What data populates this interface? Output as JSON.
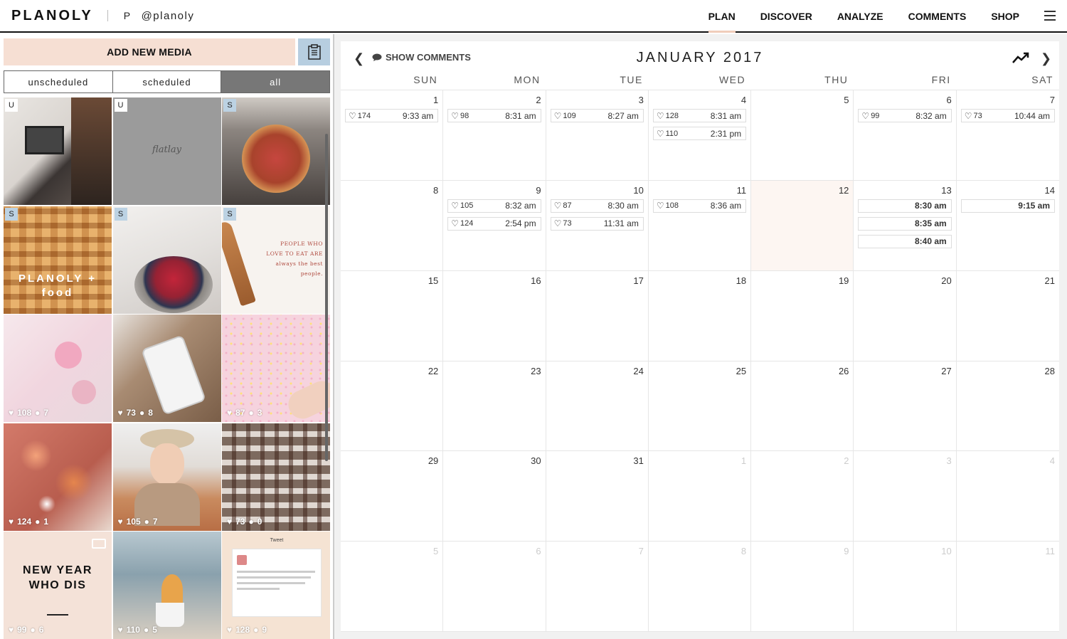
{
  "brand": {
    "logo": "PLANOLY",
    "account_initial": "P",
    "account_handle": "@planoly"
  },
  "nav": [
    {
      "label": "PLAN",
      "active": true
    },
    {
      "label": "DISCOVER",
      "active": false
    },
    {
      "label": "ANALYZE",
      "active": false
    },
    {
      "label": "COMMENTS",
      "active": false
    },
    {
      "label": "SHOP",
      "active": false
    }
  ],
  "sidebar": {
    "add_media_label": "ADD NEW MEDIA",
    "filters": [
      {
        "label": "unscheduled",
        "active": false
      },
      {
        "label": "scheduled",
        "active": false
      },
      {
        "label": "all",
        "active": true
      }
    ],
    "tiles": [
      {
        "badge": "U",
        "likes": "",
        "comments": "",
        "caption": ""
      },
      {
        "badge": "U",
        "likes": "",
        "comments": "",
        "caption": "flatlay"
      },
      {
        "badge": "S",
        "likes": "",
        "comments": "",
        "caption": ""
      },
      {
        "badge": "S",
        "likes": "",
        "comments": "",
        "caption": "PLANOLY + food"
      },
      {
        "badge": "S",
        "likes": "",
        "comments": "",
        "caption": ""
      },
      {
        "badge": "S",
        "likes": "",
        "comments": "",
        "caption": "PEOPLE WHO LOVE TO EAT ARE always the best people."
      },
      {
        "badge": "",
        "likes": "108",
        "comments": "7",
        "caption": ""
      },
      {
        "badge": "",
        "likes": "73",
        "comments": "8",
        "caption": ""
      },
      {
        "badge": "",
        "likes": "87",
        "comments": "3",
        "caption": ""
      },
      {
        "badge": "",
        "likes": "124",
        "comments": "1",
        "caption": ""
      },
      {
        "badge": "",
        "likes": "105",
        "comments": "7",
        "caption": ""
      },
      {
        "badge": "",
        "likes": "73",
        "comments": "0",
        "caption": ""
      },
      {
        "badge": "",
        "likes": "99",
        "comments": "6",
        "caption": "NEW YEAR WHO DIS"
      },
      {
        "badge": "",
        "likes": "110",
        "comments": "5",
        "caption": ""
      },
      {
        "badge": "",
        "likes": "128",
        "comments": "9",
        "caption": "Tweet"
      }
    ]
  },
  "calendar": {
    "show_comments_label": "SHOW COMMENTS",
    "month_label": "JANUARY 2017",
    "weekdays": [
      "SUN",
      "MON",
      "TUE",
      "WED",
      "THU",
      "FRI",
      "SAT"
    ],
    "days": [
      {
        "n": "1",
        "posts": [
          {
            "likes": "174",
            "time": "9:33 am"
          }
        ]
      },
      {
        "n": "2",
        "posts": [
          {
            "likes": "98",
            "time": "8:31 am"
          }
        ]
      },
      {
        "n": "3",
        "posts": [
          {
            "likes": "109",
            "time": "8:27 am"
          }
        ]
      },
      {
        "n": "4",
        "posts": [
          {
            "likes": "128",
            "time": "8:31 am"
          },
          {
            "likes": "110",
            "time": "2:31 pm"
          }
        ]
      },
      {
        "n": "5",
        "posts": []
      },
      {
        "n": "6",
        "posts": [
          {
            "likes": "99",
            "time": "8:32 am"
          }
        ]
      },
      {
        "n": "7",
        "posts": [
          {
            "likes": "73",
            "time": "10:44 am"
          }
        ]
      },
      {
        "n": "8",
        "posts": []
      },
      {
        "n": "9",
        "posts": [
          {
            "likes": "105",
            "time": "8:32 am"
          },
          {
            "likes": "124",
            "time": "2:54 pm"
          }
        ]
      },
      {
        "n": "10",
        "posts": [
          {
            "likes": "87",
            "time": "8:30 am"
          },
          {
            "likes": "73",
            "time": "11:31 am"
          }
        ]
      },
      {
        "n": "11",
        "posts": [
          {
            "likes": "108",
            "time": "8:36 am"
          }
        ]
      },
      {
        "n": "12",
        "today": true,
        "posts": []
      },
      {
        "n": "13",
        "posts": [
          {
            "likes": "",
            "time": "8:30 am"
          },
          {
            "likes": "",
            "time": "8:35 am"
          },
          {
            "likes": "",
            "time": "8:40 am"
          }
        ]
      },
      {
        "n": "14",
        "posts": [
          {
            "likes": "",
            "time": "9:15 am"
          }
        ]
      },
      {
        "n": "15",
        "posts": []
      },
      {
        "n": "16",
        "posts": []
      },
      {
        "n": "17",
        "posts": []
      },
      {
        "n": "18",
        "posts": []
      },
      {
        "n": "19",
        "posts": []
      },
      {
        "n": "20",
        "posts": []
      },
      {
        "n": "21",
        "posts": []
      },
      {
        "n": "22",
        "posts": []
      },
      {
        "n": "23",
        "posts": []
      },
      {
        "n": "24",
        "posts": []
      },
      {
        "n": "25",
        "posts": []
      },
      {
        "n": "26",
        "posts": []
      },
      {
        "n": "27",
        "posts": []
      },
      {
        "n": "28",
        "posts": []
      },
      {
        "n": "29",
        "posts": []
      },
      {
        "n": "30",
        "posts": []
      },
      {
        "n": "31",
        "posts": []
      },
      {
        "n": "1",
        "other": true,
        "posts": []
      },
      {
        "n": "2",
        "other": true,
        "posts": []
      },
      {
        "n": "3",
        "other": true,
        "posts": []
      },
      {
        "n": "4",
        "other": true,
        "posts": []
      },
      {
        "n": "5",
        "other": true,
        "posts": []
      },
      {
        "n": "6",
        "other": true,
        "posts": []
      },
      {
        "n": "7",
        "other": true,
        "posts": []
      },
      {
        "n": "8",
        "other": true,
        "posts": []
      },
      {
        "n": "9",
        "other": true,
        "posts": []
      },
      {
        "n": "10",
        "other": true,
        "posts": []
      },
      {
        "n": "11",
        "other": true,
        "posts": []
      }
    ]
  },
  "colors": {
    "accent": "#f6dfd3",
    "clip_button": "#b7cee0",
    "filter_active": "#777777",
    "today": "#fdf6f2"
  },
  "icons": {
    "clipboard": "clipboard-icon",
    "heart": "heart-icon",
    "comment": "comment-bubble-icon",
    "trend": "trend-icon",
    "menu": "hamburger-icon"
  }
}
